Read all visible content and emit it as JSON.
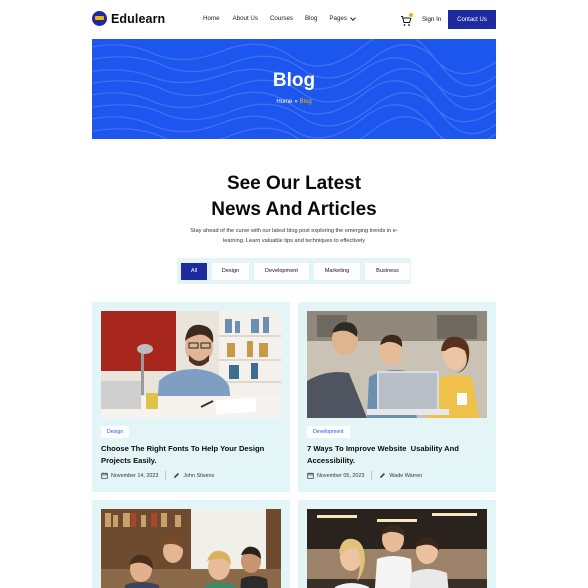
{
  "brand": {
    "name": "Edulearn"
  },
  "nav": {
    "items": [
      {
        "label": "Home"
      },
      {
        "label": "About Us"
      },
      {
        "label": "Courses"
      },
      {
        "label": "Blog"
      },
      {
        "label": "Pages"
      }
    ],
    "sign_in": "Sign In",
    "contact": "Contact Us",
    "cart_icon": "shopping-cart-icon"
  },
  "hero": {
    "title": "Blog",
    "breadcrumb": {
      "home": "Home",
      "separator": "»",
      "current": "Blog"
    }
  },
  "section": {
    "title_line1": "See Our Latest",
    "title_line2": "News And Articles",
    "subtitle_line1": "Stay ahead of the curve with our latest blog post exploring the emerging trends in e-",
    "subtitle_line2": "learning. Learn valuable tips and techniques to effectively"
  },
  "filters": [
    {
      "label": "All",
      "active": true
    },
    {
      "label": "Design",
      "active": false
    },
    {
      "label": "Development",
      "active": false
    },
    {
      "label": "Marketing",
      "active": false
    },
    {
      "label": "Business",
      "active": false
    }
  ],
  "posts": [
    {
      "tag": "Design",
      "title_line1": "Choose The Right Fonts To Help Your Design",
      "title_line2": "Projects Easily.",
      "date": "November 14, 2023",
      "author": "John Stivens"
    },
    {
      "tag": "Development",
      "title_line1": "7 Ways To Improve Website  Usability And",
      "title_line2": "Accessibility.",
      "date": "November 05, 2023",
      "author": "Wade Warren"
    }
  ],
  "colors": {
    "primary": "#1e2ba0",
    "hero_blue": "#1d56ee",
    "accent": "#f5b400",
    "card_bg": "#e4f5f8"
  }
}
